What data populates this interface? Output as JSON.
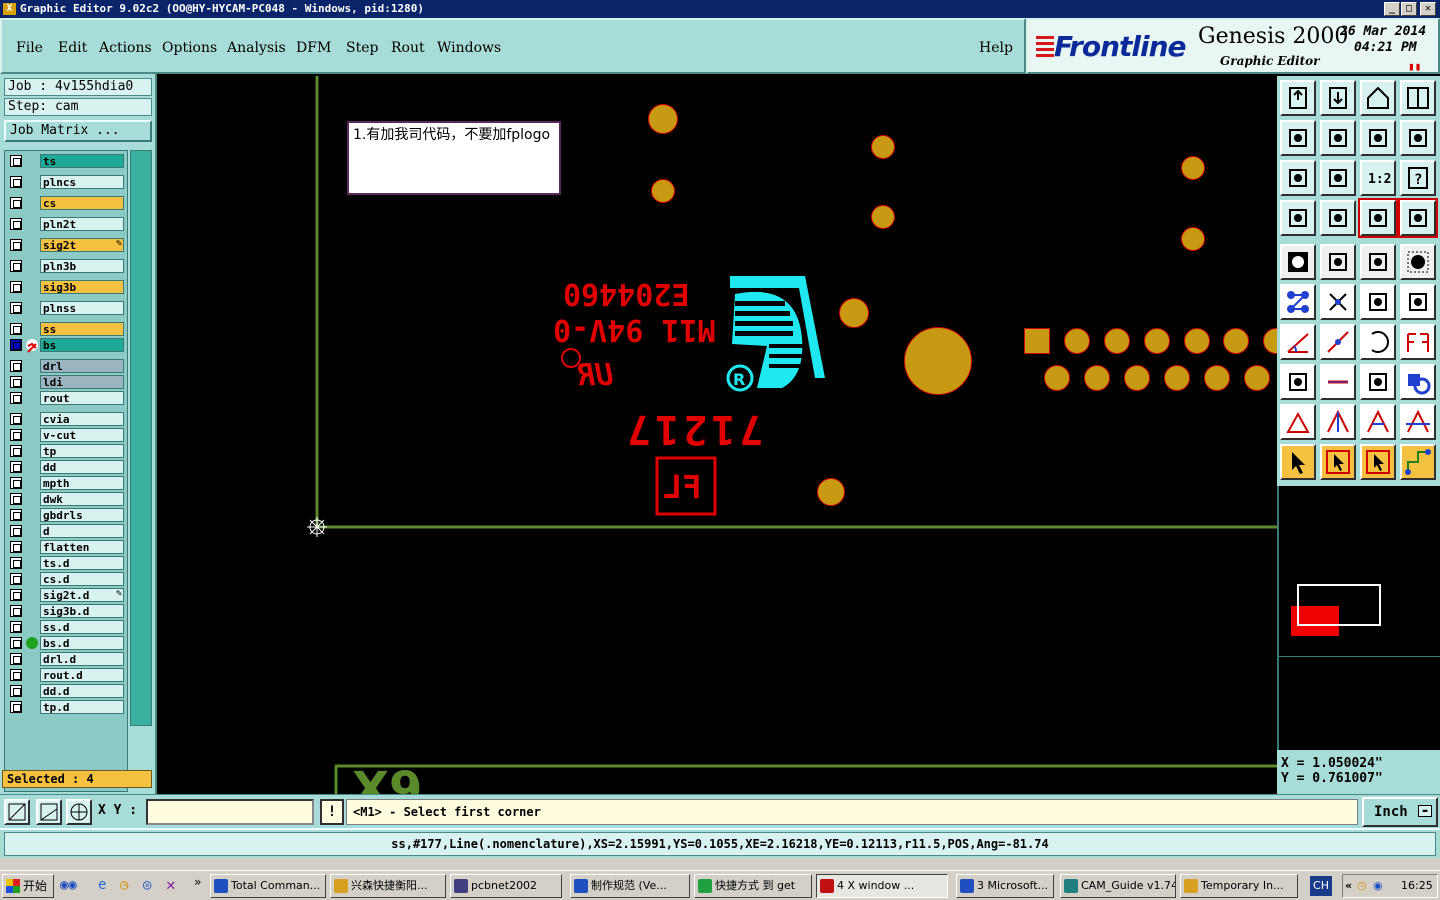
{
  "window": {
    "title": "Graphic Editor 9.02c2 (OO@HY-HYCAM-PC048 - Windows, pid:1280)",
    "min": "_",
    "max": "□",
    "close": "✕"
  },
  "menu": {
    "items": [
      "File",
      "Edit",
      "Actions",
      "Options",
      "Analysis",
      "DFM",
      "Step",
      "Rout",
      "Windows"
    ],
    "help": "Help"
  },
  "brand": {
    "logo": "Frontline",
    "product": "Genesis 2000",
    "subproduct": "Graphic Editor",
    "date": "26 Mar 2014",
    "time": "04:21 PM"
  },
  "job": {
    "job_label": "Job : 4v155hdia0",
    "step_label": "Step: cam",
    "matrix_button": "Job Matrix ..."
  },
  "layers": [
    {
      "name": "ts",
      "color": "#1ea896"
    },
    {
      "name": "plncs",
      "color": "#d8f2f0"
    },
    {
      "name": "cs",
      "color": "#f6c040"
    },
    {
      "name": "pln2t",
      "color": "#d8f2f0"
    },
    {
      "name": "sig2t",
      "color": "#f6c040",
      "mark": "✎"
    },
    {
      "name": "pln3b",
      "color": "#d8f2f0"
    },
    {
      "name": "sig3b",
      "color": "#f6c040"
    },
    {
      "name": "plnss",
      "color": "#d8f2f0"
    },
    {
      "name": "ss",
      "color": "#f6c040"
    },
    {
      "name": "bs",
      "color": "#1ea896",
      "active": true
    },
    {
      "name": "drl",
      "color": "#9ab4c0"
    },
    {
      "name": "ldi",
      "color": "#9ab4c0"
    },
    {
      "name": "rout",
      "color": "#d8f2f0"
    },
    {
      "name": "cvia",
      "color": "#d8f2f0"
    },
    {
      "name": "v-cut",
      "color": "#d8f2f0"
    },
    {
      "name": "tp",
      "color": "#d8f2f0"
    },
    {
      "name": "dd",
      "color": "#d8f2f0"
    },
    {
      "name": "mpth",
      "color": "#d8f2f0"
    },
    {
      "name": "dwk",
      "color": "#d8f2f0"
    },
    {
      "name": "gbdrls",
      "color": "#d8f2f0"
    },
    {
      "name": "d",
      "color": "#d8f2f0"
    },
    {
      "name": "flatten",
      "color": "#d8f2f0"
    },
    {
      "name": "ts.d",
      "color": "#d8f2f0"
    },
    {
      "name": "cs.d",
      "color": "#d8f2f0"
    },
    {
      "name": "sig2t.d",
      "color": "#d8f2f0",
      "mark": "✎"
    },
    {
      "name": "sig3b.d",
      "color": "#d8f2f0"
    },
    {
      "name": "ss.d",
      "color": "#d8f2f0"
    },
    {
      "name": "bs.d",
      "color": "#d8f2f0",
      "dot": true
    },
    {
      "name": "drl.d",
      "color": "#d8f2f0"
    },
    {
      "name": "rout.d",
      "color": "#d8f2f0"
    },
    {
      "name": "dd.d",
      "color": "#d8f2f0"
    },
    {
      "name": "tp.d",
      "color": "#d8f2f0"
    }
  ],
  "selected_label": "Selected : 4",
  "note": {
    "text": "1.有加我司代码，不要加fplogo"
  },
  "silkscreen": {
    "line1": "E204460",
    "line2": "M11 94V-0",
    "line3": "UR",
    "line4": "71217",
    "line5": "FL"
  },
  "coords": {
    "x": "X = 1.050024\"",
    "y": "Y = 0.761007\""
  },
  "command": {
    "xy_label": "X Y :",
    "xy_value": "",
    "bang": "!",
    "prompt": "<M1> - Select first corner",
    "units": "Inch"
  },
  "status": "ss,#177,Line(.nomenclature),XS=2.15991,YS=0.1055,XE=2.16218,YE=0.12113,r11.5,POS,Ang=-81.74",
  "taskbar": {
    "start": "开始",
    "buttons": [
      {
        "label": "Total Comman...",
        "color": "#2050c0"
      },
      {
        "label": "兴森快捷衡阳...",
        "color": "#d8a020"
      },
      {
        "label": "pcbnet2002",
        "color": "#404080"
      },
      {
        "label": "制作规范 (Ve...",
        "color": "#2050c0"
      },
      {
        "label": "快捷方式 到 get",
        "color": "#20a040"
      },
      {
        "label": "4 X window ...",
        "color": "#c01010"
      },
      {
        "label": "3 Microsoft...",
        "color": "#2050c0"
      },
      {
        "label": "CAM_Guide v1.74",
        "color": "#208080"
      },
      {
        "label": "Temporary In...",
        "color": "#d8a020"
      }
    ],
    "lang": "CH",
    "clock": "16:25"
  },
  "colors": {
    "panel": "#a8dcd8",
    "pad": "#c89a14",
    "silk_red": "#e00000",
    "logo_cyan": "#20e8f0",
    "outline_green": "#5a8a2a"
  }
}
